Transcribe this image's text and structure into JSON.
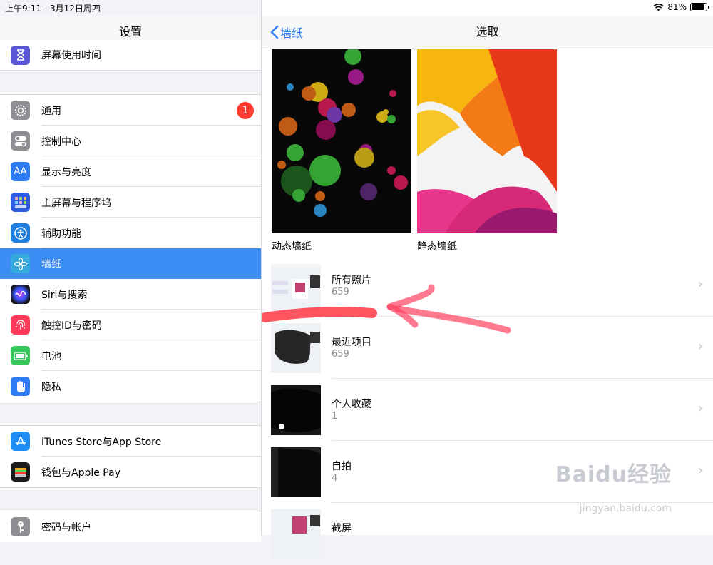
{
  "status": {
    "time": "上午9:11",
    "date": "3月12日周四",
    "battery": "81%"
  },
  "sidebar": {
    "title": "设置",
    "group0": [
      {
        "label": "屏幕使用时间",
        "icon": "hourglass-icon",
        "color": "#5856d6"
      }
    ],
    "group1": [
      {
        "label": "通用",
        "icon": "gear-icon",
        "color": "#8e8e93",
        "badge": "1"
      },
      {
        "label": "控制中心",
        "icon": "toggles-icon",
        "color": "#8e8e93"
      },
      {
        "label": "显示与亮度",
        "icon": "text-size-icon",
        "color": "#2d7cf6"
      },
      {
        "label": "主屏幕与程序坞",
        "icon": "home-grid-icon",
        "color": "#2d5ce0"
      },
      {
        "label": "辅助功能",
        "icon": "accessibility-icon",
        "color": "#1f7fe0"
      },
      {
        "label": "墙纸",
        "icon": "flower-icon",
        "color": "#36aadc",
        "selected": true
      },
      {
        "label": "Siri与搜索",
        "icon": "siri-icon",
        "color": "#222"
      },
      {
        "label": "触控ID与密码",
        "icon": "fingerprint-icon",
        "color": "#ff3b5c"
      },
      {
        "label": "电池",
        "icon": "battery-icon",
        "color": "#34c759"
      },
      {
        "label": "隐私",
        "icon": "hand-icon",
        "color": "#2d7cf6"
      }
    ],
    "group2": [
      {
        "label": "iTunes Store与App Store",
        "icon": "app-store-icon",
        "color": "#1e8cf5"
      },
      {
        "label": "钱包与Apple Pay",
        "icon": "wallet-icon",
        "color": "#1c1c1e"
      }
    ],
    "group3": [
      {
        "label": "密码与帐户",
        "icon": "key-icon",
        "color": "#8e8e93"
      }
    ]
  },
  "main": {
    "back_label": "墙纸",
    "title": "选取",
    "wallpapers": [
      {
        "label": "动态墙纸"
      },
      {
        "label": "静态墙纸"
      }
    ],
    "albums": [
      {
        "name": "所有照片",
        "count": "659"
      },
      {
        "name": "最近项目",
        "count": "659"
      },
      {
        "name": "个人收藏",
        "count": "1"
      },
      {
        "name": "自拍",
        "count": "4"
      },
      {
        "name": "截屏",
        "count": ""
      }
    ]
  },
  "watermark": {
    "text": "Baidu经验",
    "sub": "jingyan.baidu.com"
  }
}
